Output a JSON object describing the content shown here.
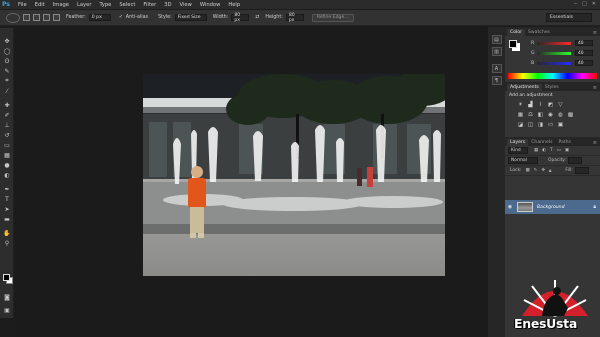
{
  "app": {
    "logo": "Ps"
  },
  "menu": [
    "File",
    "Edit",
    "Image",
    "Layer",
    "Type",
    "Select",
    "Filter",
    "3D",
    "View",
    "Window",
    "Help"
  ],
  "options": {
    "feather_label": "Feather:",
    "feather_value": "0 px",
    "antialias_label": "Anti-alias",
    "style_label": "Style:",
    "style_value": "Fixed Size",
    "width_label": "Width:",
    "width_value": "80 px",
    "height_label": "Height:",
    "height_value": "80 px",
    "refine_label": "Refine Edge...",
    "workspace": "Essentials"
  },
  "color_panel": {
    "tabs": [
      "Color",
      "Swatches"
    ],
    "r_label": "R",
    "r_value": "40",
    "g_label": "G",
    "g_value": "40",
    "b_label": "B",
    "b_value": "40"
  },
  "adjustments_panel": {
    "tabs": [
      "Adjustments",
      "Styles"
    ],
    "title": "Add an adjustment"
  },
  "layers_panel": {
    "tabs": [
      "Layers",
      "Channels",
      "Paths"
    ],
    "kind_value": "Kind",
    "blend_mode": "Normal",
    "opacity_label": "Opacity:",
    "lock_label": "Lock:",
    "fill_label": "Fill:",
    "layer_name": "Background"
  },
  "watermark": {
    "text": "EnesUsta"
  }
}
